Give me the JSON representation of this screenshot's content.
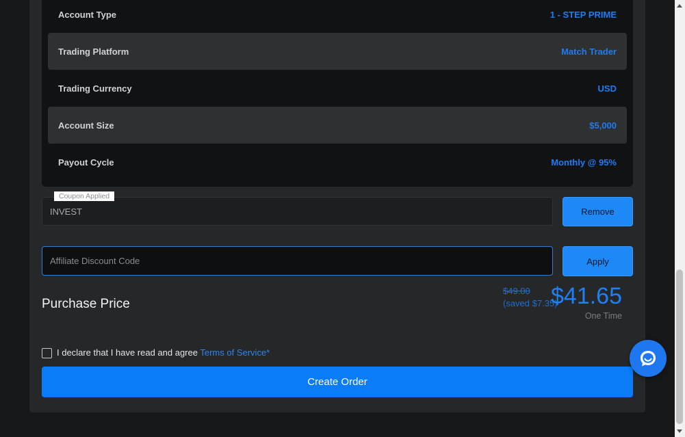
{
  "summary": {
    "rows": [
      {
        "label": "Account Type",
        "value": "1 - STEP PRIME"
      },
      {
        "label": "Trading Platform",
        "value": "Match Trader"
      },
      {
        "label": "Trading Currency",
        "value": "USD"
      },
      {
        "label": "Account Size",
        "value": "$5,000"
      },
      {
        "label": "Payout Cycle",
        "value": "Monthly @ 95%"
      }
    ]
  },
  "coupon": {
    "tag": "Coupon Applied",
    "code": "INVEST",
    "remove_label": "Remove"
  },
  "affiliate": {
    "placeholder": "Affiliate Discount Code",
    "apply_label": "Apply"
  },
  "purchase": {
    "label": "Purchase Price",
    "old_price": "$49.00",
    "saved": "(saved $7.35)",
    "price": "$41.65",
    "billing": "One Time"
  },
  "terms": {
    "declare_text": "I declare that I have read and agree",
    "tos_link": "Terms of Service*"
  },
  "create_order_label": "Create Order",
  "colors": {
    "accent": "#1e80f4",
    "background": "#161718",
    "card": "#262728"
  }
}
